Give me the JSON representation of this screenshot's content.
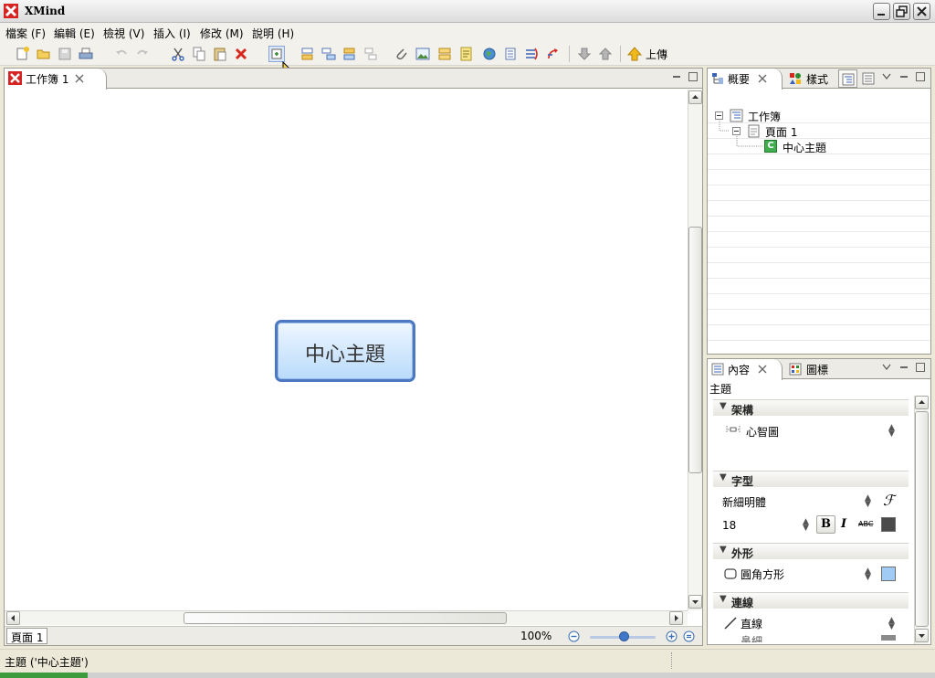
{
  "window": {
    "title": "XMind"
  },
  "menu": [
    "檔案 (F)",
    "編輯 (E)",
    "檢視 (V)",
    "插入 (I)",
    "修改 (M)",
    "說明 (H)"
  ],
  "toolbar": {
    "upload_label": "上傳"
  },
  "editor": {
    "tab_label": "工作簿 1",
    "central_topic": "中心主題",
    "sheet_tab": "頁面 1",
    "zoom": "100%"
  },
  "outline_panel": {
    "tab_overview": "概要",
    "tab_style": "樣式",
    "tree": {
      "workbook": "工作簿",
      "sheet": "頁面 1",
      "topic": "中心主題"
    }
  },
  "props_panel": {
    "tab_content": "內容",
    "tab_icons": "圖標",
    "subtitle": "主題",
    "structure": {
      "header": "架構",
      "value": "心智圖"
    },
    "font": {
      "header": "字型",
      "family": "新細明體",
      "size": "18",
      "bold": "B",
      "italic": "I",
      "strike": "ABC",
      "color": "#4a4a4a"
    },
    "shape": {
      "header": "外形",
      "value": "圓角方形",
      "fill_color": "#9fcbf5"
    },
    "line": {
      "header": "連線",
      "value": "直線",
      "partial": "鼻細"
    }
  },
  "statusbar": {
    "text": "主題 ('中心主題')"
  },
  "colors": {
    "accent_red": "#d62424",
    "topic_border": "#4a78c2",
    "topic_fill": "#b9dbfb"
  }
}
